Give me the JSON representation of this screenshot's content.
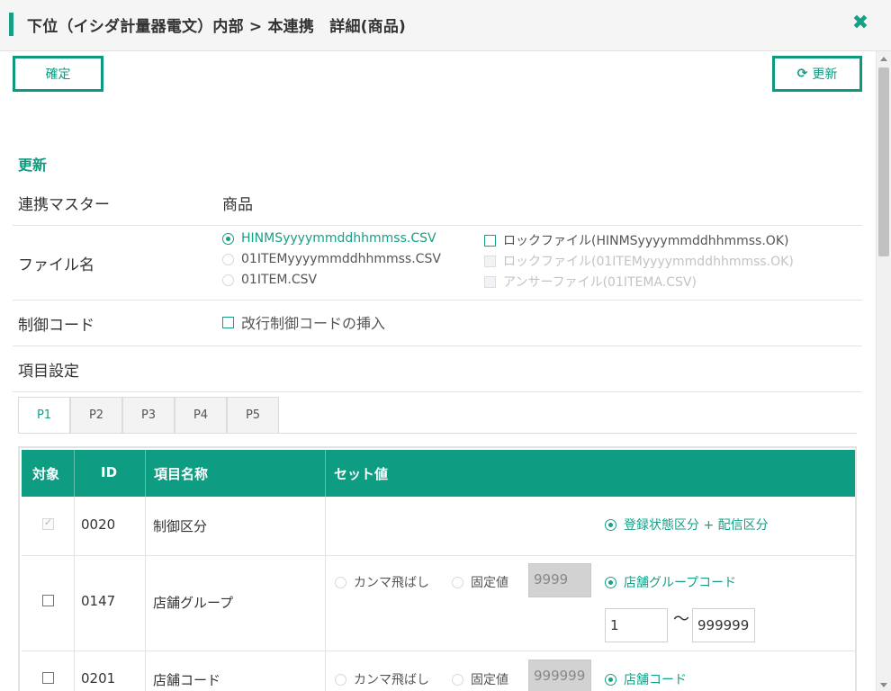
{
  "window": {
    "title": "下位（イシダ計量器電文）内部 > 本連携　詳細(商品)",
    "close_icon": "close-icon"
  },
  "toolbar": {
    "confirm_label": "確定",
    "update_label": "更新",
    "update_icon": "refresh-icon"
  },
  "section": {
    "title": "更新"
  },
  "form": {
    "master": {
      "label": "連携マスター",
      "value": "商品"
    },
    "filename": {
      "label": "ファイル名",
      "files": [
        {
          "label": "HINMSyyyymmddhhmmss.CSV",
          "selected": true
        },
        {
          "label": "01ITEMyyyymmddhhmmss.CSV",
          "selected": false
        },
        {
          "label": "01ITEM.CSV",
          "selected": false
        }
      ],
      "locks": [
        {
          "label": "ロックファイル(HINMSyyyymmddhhmmss.OK)",
          "enabled": true
        },
        {
          "label": "ロックファイル(01ITEMyyyymmddhhmmss.OK)",
          "enabled": false
        },
        {
          "label": "アンサーファイル(01ITEMA.CSV)",
          "enabled": false
        }
      ]
    },
    "control_code": {
      "label": "制御コード",
      "option": "改行制御コードの挿入"
    },
    "item_settings": {
      "label": "項目設定"
    }
  },
  "tabs": [
    "P1",
    "P2",
    "P3",
    "P4",
    "P5"
  ],
  "active_tab": "P1",
  "grid": {
    "columns": [
      "対象",
      "ID",
      "項目名称",
      "セット値"
    ],
    "rows": [
      {
        "id": "0020",
        "name": "制御区分",
        "set_option": "登録状態区分 + 配信区分"
      },
      {
        "id": "0147",
        "name": "店舗グループ",
        "comma_skip": "カンマ飛ばし",
        "fixed_label": "固定値",
        "fixed_value": "9999",
        "set_option": "店舗グループコード",
        "range_from": "1",
        "range_tilde": "〜",
        "range_to": "999999"
      },
      {
        "id": "0201",
        "name": "店舗コード",
        "comma_skip": "カンマ飛ばし",
        "fixed_label": "固定値",
        "fixed_value": "999999",
        "set_option": "店舗コード"
      }
    ]
  },
  "colors": {
    "accent": "#16a085",
    "header_bg": "#0e9c82",
    "disabled_text": "#c3c3c3"
  }
}
